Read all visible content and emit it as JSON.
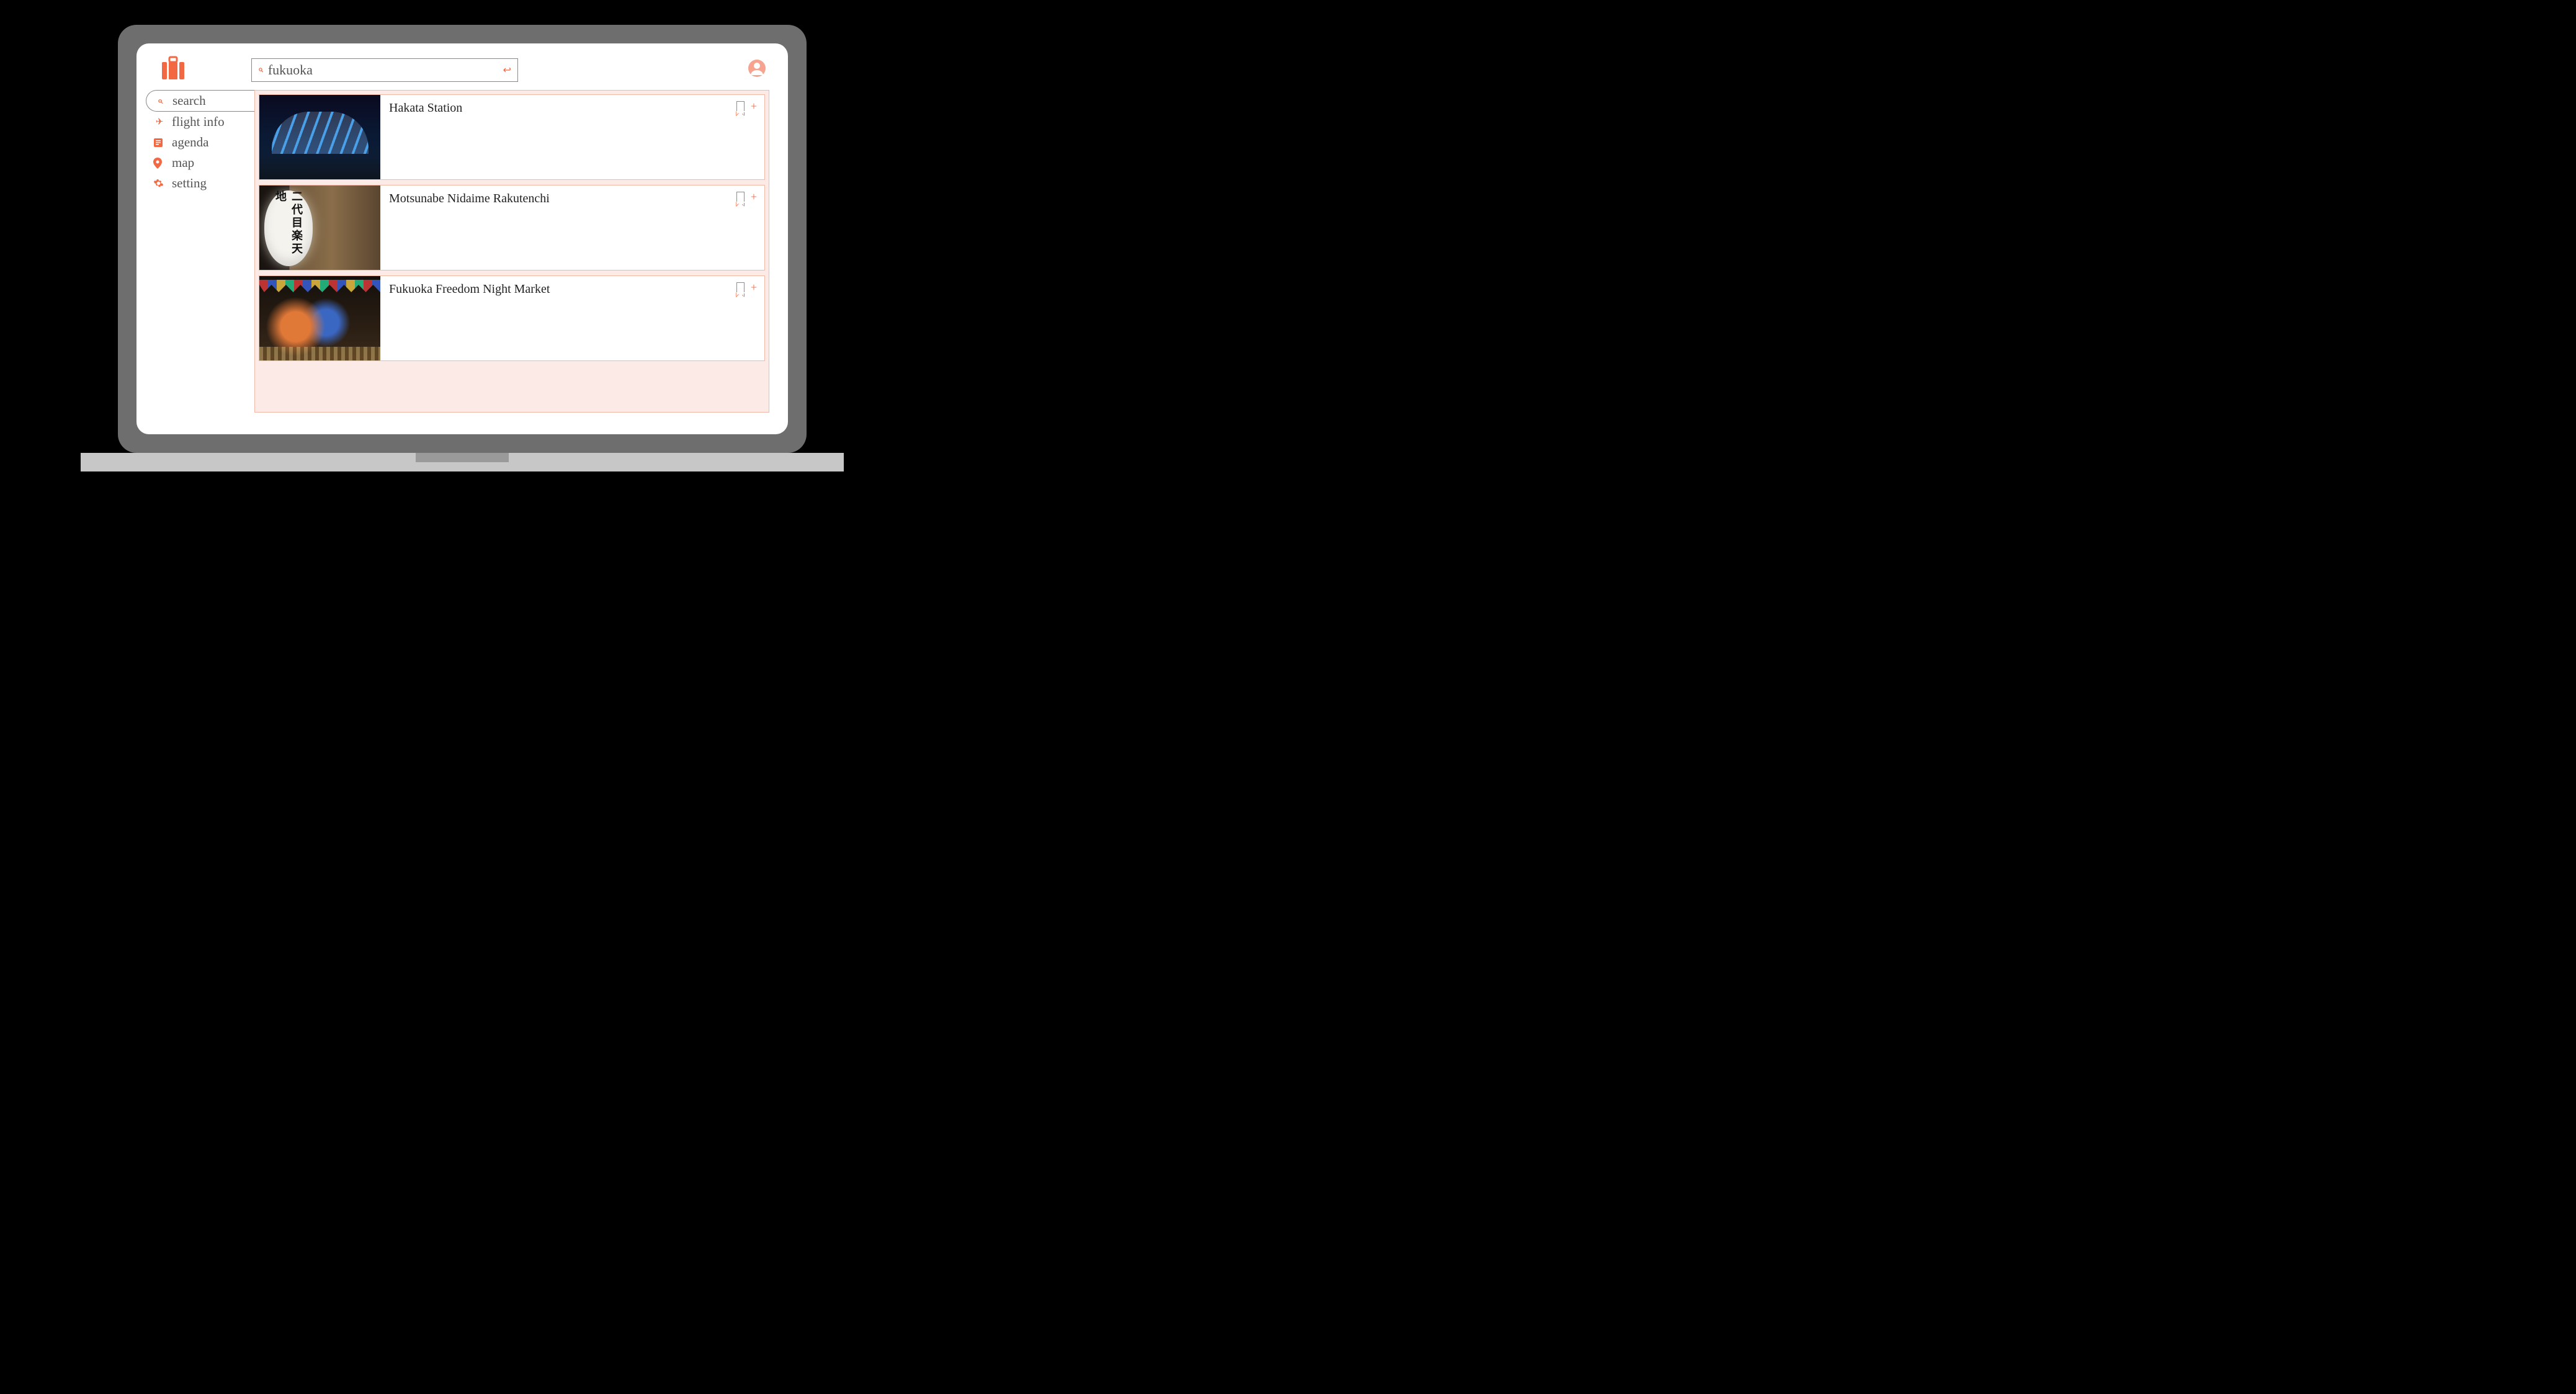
{
  "colors": {
    "accent": "#f26843",
    "accent_light": "#f6a48f",
    "panel_bg": "#fbeae5",
    "panel_border": "#f3b9a7"
  },
  "search": {
    "value": "fukuoka",
    "placeholder": ""
  },
  "sidebar": {
    "items": [
      {
        "icon": "search-icon",
        "label": "search",
        "active": true
      },
      {
        "icon": "plane-icon",
        "label": "flight info",
        "active": false
      },
      {
        "icon": "agenda-icon",
        "label": "agenda",
        "active": false
      },
      {
        "icon": "map-pin-icon",
        "label": "map",
        "active": false
      },
      {
        "icon": "gear-icon",
        "label": "setting",
        "active": false
      }
    ]
  },
  "results": [
    {
      "title": "Hakata Station",
      "thumb_kind": "station",
      "lantern_text": ""
    },
    {
      "title": "Motsunabe Nidaime Rakutenchi",
      "thumb_kind": "lantern",
      "lantern_text": "二代目楽天地"
    },
    {
      "title": "Fukuoka Freedom Night Market",
      "thumb_kind": "market",
      "lantern_text": ""
    }
  ]
}
